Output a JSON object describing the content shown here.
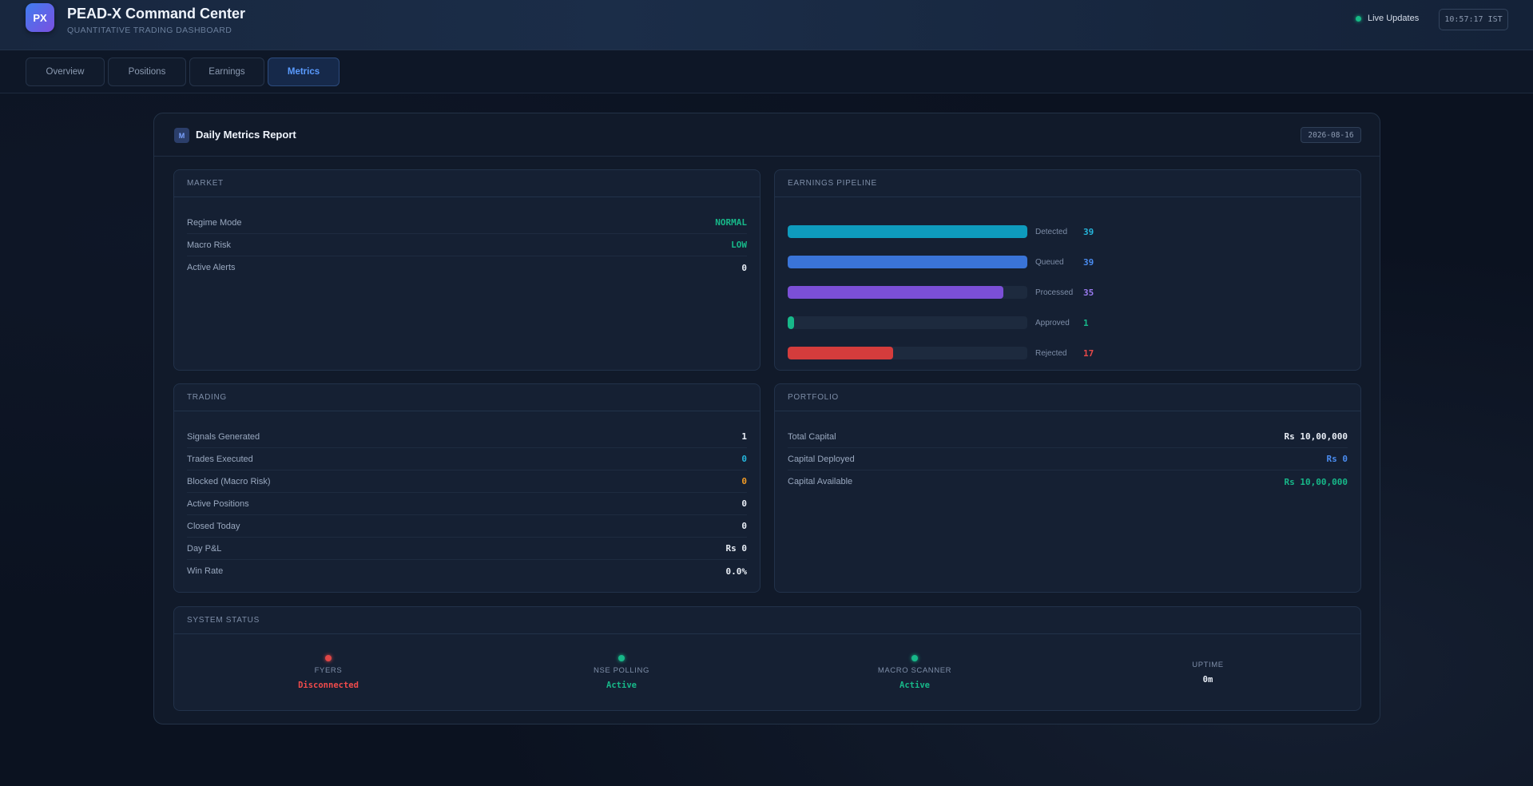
{
  "header": {
    "logo_text": "PX",
    "title": "PEAD-X Command Center",
    "subtitle": "QUANTITATIVE TRADING DASHBOARD",
    "live_label": "Live Updates",
    "clock": "10:57:17 IST"
  },
  "tabs": [
    {
      "label": "Overview",
      "active": false
    },
    {
      "label": "Positions",
      "active": false
    },
    {
      "label": "Earnings",
      "active": false
    },
    {
      "label": "Metrics",
      "active": true
    }
  ],
  "report": {
    "icon_letter": "M",
    "title": "Daily Metrics Report",
    "date": "2026-08-16"
  },
  "market": {
    "heading": "MARKET",
    "rows": [
      {
        "label": "Regime Mode",
        "value": "NORMAL",
        "color": "#17b889"
      },
      {
        "label": "Macro Risk",
        "value": "LOW",
        "color": "#17b889"
      },
      {
        "label": "Active Alerts",
        "value": "0",
        "color": "#e9eef6"
      }
    ]
  },
  "pipeline": {
    "heading": "EARNINGS PIPELINE",
    "stages": [
      {
        "label": "Detected",
        "value": "39",
        "fill": 1.0,
        "color": "#0e9bbd",
        "text_color": "#25b6dc"
      },
      {
        "label": "Queued",
        "value": "39",
        "fill": 1.0,
        "color": "#3a74d8",
        "text_color": "#4a8cf0"
      },
      {
        "label": "Processed",
        "value": "35",
        "fill": 0.9,
        "color": "#7b4fd6",
        "text_color": "#9a7af0"
      },
      {
        "label": "Approved",
        "value": "1",
        "fill": 0.026,
        "color": "#17b889",
        "text_color": "#17b889"
      },
      {
        "label": "Rejected",
        "value": "17",
        "fill": 0.44,
        "color": "#d43c3c",
        "text_color": "#e44848"
      }
    ]
  },
  "trading": {
    "heading": "TRADING",
    "rows": [
      {
        "label": "Signals Generated",
        "value": "1",
        "color": "#e9eef6"
      },
      {
        "label": "Trades Executed",
        "value": "0",
        "color": "#25b6dc"
      },
      {
        "label": "Blocked (Macro Risk)",
        "value": "0",
        "color": "#f29b25"
      },
      {
        "label": "Active Positions",
        "value": "0",
        "color": "#e9eef6"
      },
      {
        "label": "Closed Today",
        "value": "0",
        "color": "#e9eef6"
      },
      {
        "label": "Day P&L",
        "value": "Rs 0",
        "color": "#e9eef6"
      },
      {
        "label": "Win Rate",
        "value": "0.0%",
        "color": "#e9eef6"
      }
    ]
  },
  "portfolio": {
    "heading": "PORTFOLIO",
    "rows": [
      {
        "label": "Total Capital",
        "value": "Rs 10,00,000",
        "color": "#e9eef6"
      },
      {
        "label": "Capital Deployed",
        "value": "Rs 0",
        "color": "#4a8cf0"
      },
      {
        "label": "Capital Available",
        "value": "Rs 10,00,000",
        "color": "#17b889"
      }
    ]
  },
  "system_status": {
    "heading": "SYSTEM STATUS",
    "items": [
      {
        "name": "FYERS",
        "value": "Disconnected",
        "dot": "#e04646",
        "color": "#f04b4b"
      },
      {
        "name": "NSE POLLING",
        "value": "Active",
        "dot": "#17b889",
        "color": "#17b889"
      },
      {
        "name": "MACRO SCANNER",
        "value": "Active",
        "dot": "#17b889",
        "color": "#17b889"
      },
      {
        "name": "UPTIME",
        "value": "0m",
        "dot": "",
        "color": "#e9eef6"
      }
    ]
  }
}
